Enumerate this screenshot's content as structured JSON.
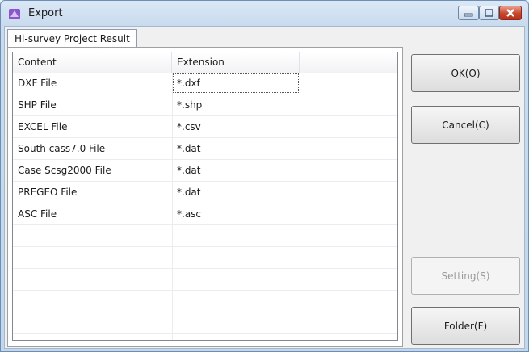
{
  "window": {
    "title": "Export",
    "controls": {
      "minimize": "minimize",
      "maximize": "maximize",
      "close": "close"
    }
  },
  "tabs": [
    {
      "label": "Hi-survey Project Result",
      "selected": true
    }
  ],
  "table": {
    "columns": [
      "Content",
      "Extension",
      ""
    ],
    "rows": [
      {
        "content": "DXF File",
        "extension": "*.dxf"
      },
      {
        "content": "SHP File",
        "extension": "*.shp"
      },
      {
        "content": "EXCEL File",
        "extension": "*.csv"
      },
      {
        "content": "South cass7.0 File",
        "extension": "*.dat"
      },
      {
        "content": "Case Scsg2000 File",
        "extension": "*.dat"
      },
      {
        "content": "PREGEO File",
        "extension": "*.dat"
      },
      {
        "content": "ASC File",
        "extension": "*.asc"
      }
    ]
  },
  "buttons": {
    "ok": "OK(O)",
    "cancel": "Cancel(C)",
    "setting": "Setting(S)",
    "folder": "Folder(F)"
  }
}
